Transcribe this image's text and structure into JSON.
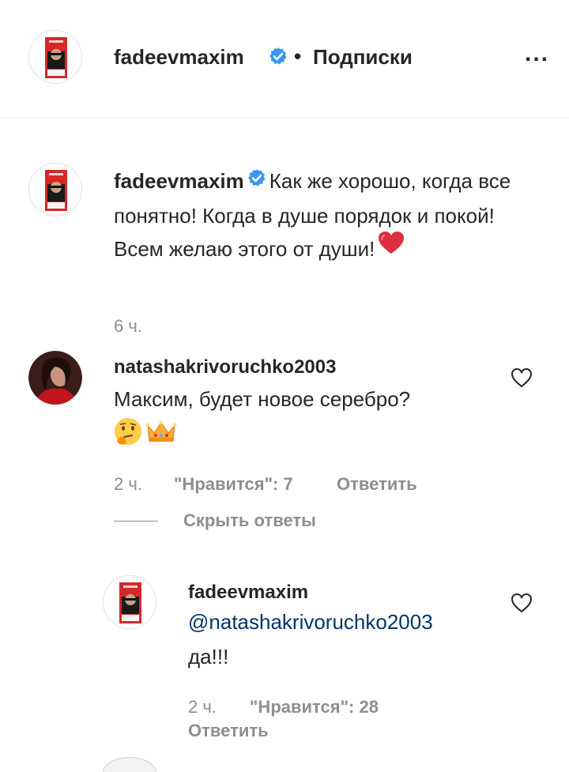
{
  "header": {
    "username": "fadeevmaxim",
    "dot": "•",
    "follow_label": "Подписки",
    "more_label": "..."
  },
  "caption": {
    "username": "fadeevmaxim",
    "text": "Как же хорошо, когда все понятно! Когда в душе порядок и покой! Всем желаю этого от души!",
    "time": "6 ч."
  },
  "comments": [
    {
      "username": "natashakrivoruchko2003",
      "text": "Максим, будет новое серебро?",
      "time": "2 ч.",
      "likes": "\"Нравится\": 7",
      "reply_label": "Ответить",
      "hide_replies_label": "Скрыть ответы",
      "replies": [
        {
          "username": "fadeevmaxim",
          "mention": "@natashakrivoruchko2003",
          "text": "да!!!",
          "time": "2 ч.",
          "likes": "\"Нравится\": 28",
          "reply_label": "Ответить"
        }
      ]
    }
  ],
  "icons": {
    "verified": "verified-badge-icon",
    "like": "heart-outline-icon",
    "heart_emoji": "red-heart-emoji",
    "thinking_emoji": "thinking-face-emoji",
    "crown_emoji": "crown-emoji"
  },
  "colors": {
    "verified_blue": "#3897f0",
    "muted": "#8e8e8e",
    "text": "#262626",
    "mention": "#003569",
    "heart_red": "#ed4956"
  }
}
